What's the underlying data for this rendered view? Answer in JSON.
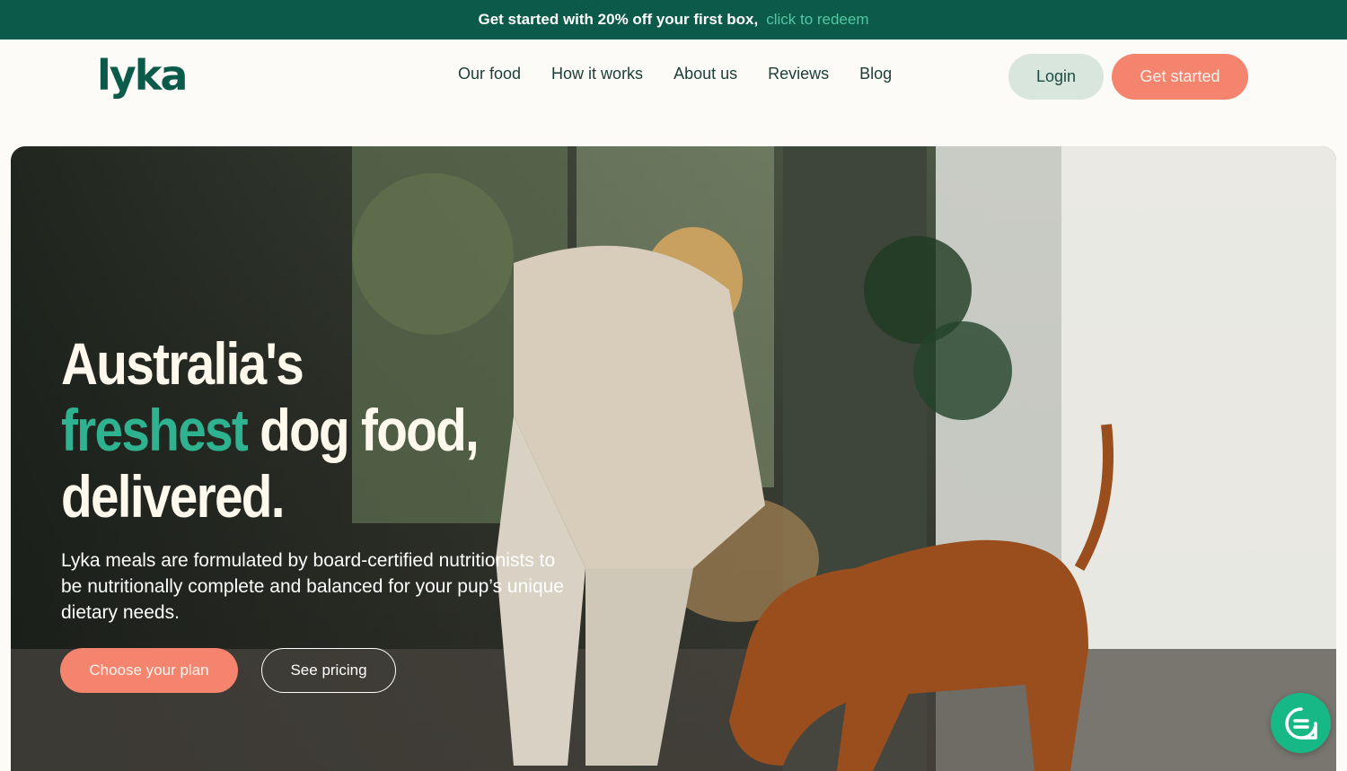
{
  "promo": {
    "text": "Get started with 20% off your first box,",
    "link": "click to redeem"
  },
  "header": {
    "logo": "lyka",
    "nav": [
      "Our food",
      "How it works",
      "About us",
      "Reviews",
      "Blog"
    ],
    "login": "Login",
    "get_started": "Get started"
  },
  "hero": {
    "headline_1": "Australia's",
    "headline_accent": "freshest",
    "headline_2": " dog food,",
    "headline_3": "delivered.",
    "subtext": "Lyka meals are formulated by board-certified nutritionists to be nutritionally complete and balanced for your pup’s unique dietary needs.",
    "primary_cta": "Choose your plan",
    "secondary_cta": "See pricing"
  },
  "chat": {
    "icon": "chat-bubble-icon"
  },
  "colors": {
    "brand_green": "#0b5a4a",
    "accent_green": "#2fb28f",
    "coral": "#f4846d"
  }
}
